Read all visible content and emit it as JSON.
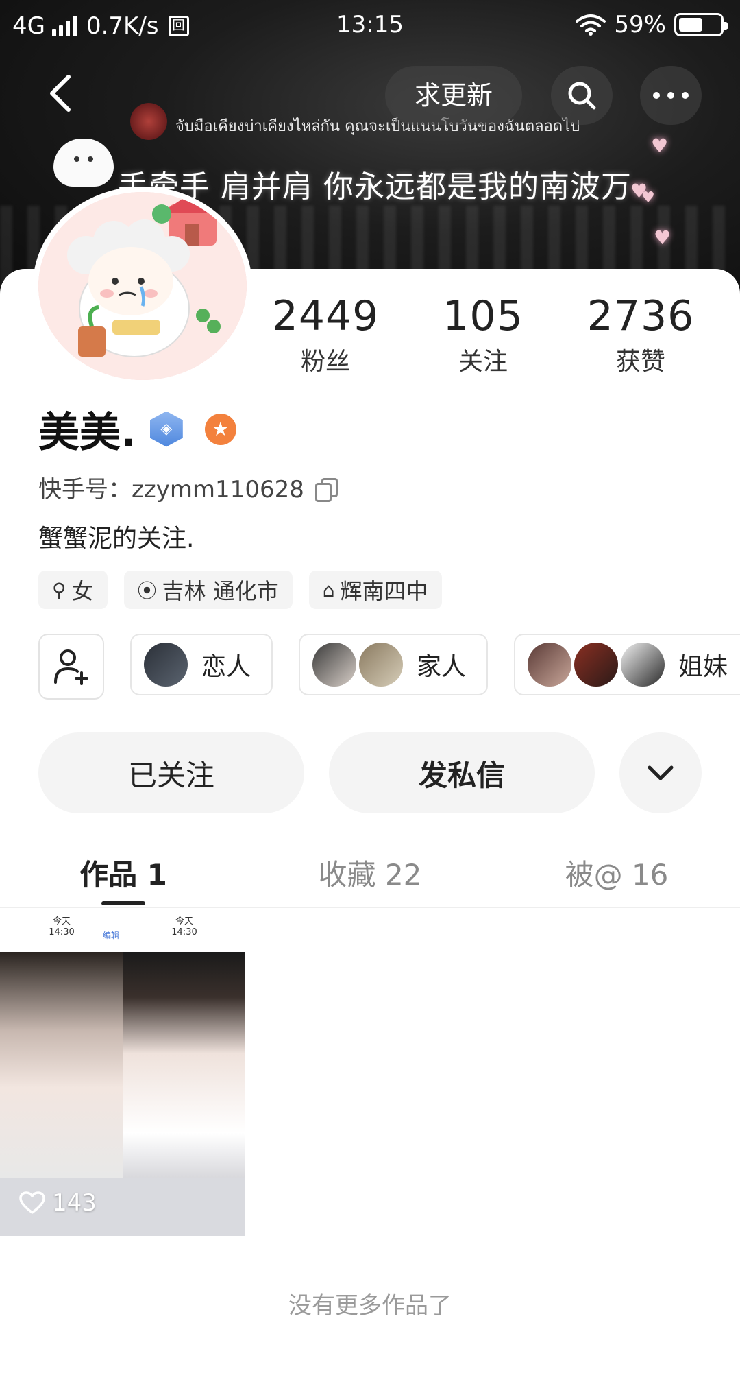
{
  "status_bar": {
    "network": "4G",
    "speed": "0.7K/s",
    "box_glyph": "回",
    "time": "13:15",
    "battery": "59%",
    "battery_level": 0.59
  },
  "header": {
    "banner_thai": "จับมือเคียงบ่าเคียงไหล่กัน คุณจะเป็นแนนโบวันของฉันตลอดไป",
    "banner_cn": "手牵手 肩并肩 你永远都是我的南波万",
    "update_button": "求更新"
  },
  "profile": {
    "stats": [
      {
        "value": "2449",
        "label": "粉丝"
      },
      {
        "value": "105",
        "label": "关注"
      },
      {
        "value": "2736",
        "label": "获赞"
      }
    ],
    "name": "美美.",
    "uid_label": "快手号：",
    "uid": "zzymm110628",
    "bio": "蟹蟹泥的关注.",
    "tags": [
      {
        "icon": "⚲",
        "text": "女"
      },
      {
        "icon": "⦿",
        "text": "吉林 通化市"
      },
      {
        "icon": "⌂",
        "text": "辉南四中"
      }
    ],
    "relations": [
      {
        "label": "恋人"
      },
      {
        "label": "家人"
      },
      {
        "label": "姐妹"
      }
    ]
  },
  "actions": {
    "followed": "已关注",
    "message": "发私信"
  },
  "tabs": [
    {
      "label": "作品 1"
    },
    {
      "label": "收藏 22"
    },
    {
      "label": "被@ 16"
    }
  ],
  "posts": [
    {
      "likes": "143",
      "left_header_day": "今天",
      "left_header_time": "14:30",
      "left_header_edit": "编辑",
      "right_header_day": "今天",
      "right_header_time": "14:30",
      "top_time": "14:30"
    }
  ],
  "footer": {
    "no_more": "没有更多作品了"
  },
  "colors": {
    "accent_star": "#f3813d",
    "badge_blue": "#4e87de",
    "text_muted": "#9a9a9a"
  }
}
